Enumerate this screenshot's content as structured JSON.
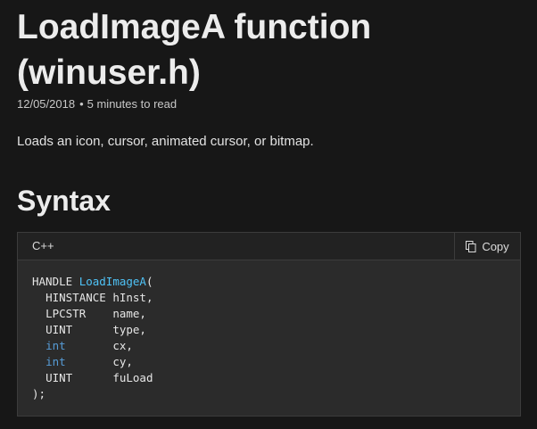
{
  "article": {
    "title": "LoadImageA function (winuser.h)",
    "date": "12/05/2018",
    "separator": "•",
    "read_time": "5 minutes to read",
    "summary": "Loads an icon, cursor, animated cursor, or bitmap.",
    "syntax_heading": "Syntax"
  },
  "code_block": {
    "language": "C++",
    "copy_label": "Copy",
    "copy_icon": "copy-icon",
    "lines": [
      {
        "type_name": "HANDLE",
        "rest_prefix": " ",
        "name": "LoadImageA",
        "rest": "("
      },
      {
        "indent": "  ",
        "type_name": "HINSTANCE",
        "pad": " ",
        "param": "hInst,"
      },
      {
        "indent": "  ",
        "type_name": "LPCSTR",
        "pad": "    ",
        "param": "name,"
      },
      {
        "indent": "  ",
        "type_name": "UINT",
        "pad": "      ",
        "param": "type,"
      },
      {
        "indent": "  ",
        "type_name": "int",
        "pad": "       ",
        "param": "cx,"
      },
      {
        "indent": "  ",
        "type_name": "int",
        "pad": "       ",
        "param": "cy,"
      },
      {
        "indent": "  ",
        "type_name": "UINT",
        "pad": "      ",
        "param": "fuLoad"
      },
      {
        "text": ");"
      }
    ]
  },
  "colors": {
    "background": "#171717",
    "code_background": "#2b2b2b",
    "function_name": "#4fc3f7",
    "keyword": "#569cd6"
  }
}
